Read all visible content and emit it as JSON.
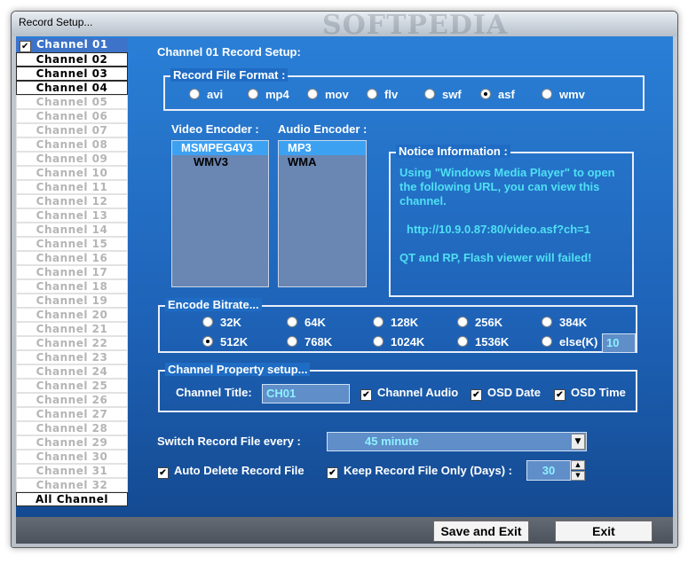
{
  "window": {
    "title": "Record Setup...",
    "watermark": "SOFTPEDIA"
  },
  "channels": {
    "items": [
      "Channel 01",
      "Channel 02",
      "Channel 03",
      "Channel 04",
      "Channel 05",
      "Channel 06",
      "Channel 07",
      "Channel 08",
      "Channel 09",
      "Channel 10",
      "Channel 11",
      "Channel 12",
      "Channel 13",
      "Channel 14",
      "Channel 15",
      "Channel 16",
      "Channel 17",
      "Channel 18",
      "Channel 19",
      "Channel 20",
      "Channel 21",
      "Channel 22",
      "Channel 23",
      "Channel 24",
      "Channel 25",
      "Channel 26",
      "Channel 27",
      "Channel 28",
      "Channel 29",
      "Channel 30",
      "Channel 31",
      "Channel 32"
    ],
    "active_indices": [
      1,
      2,
      3
    ],
    "selected_index": 0,
    "all_label": "All Channel"
  },
  "setup": {
    "heading": "Channel 01 Record Setup:",
    "format_legend": "Record File Format :",
    "formats": [
      "avi",
      "mp4",
      "mov",
      "flv",
      "swf",
      "asf",
      "wmv"
    ],
    "format_selected": "asf"
  },
  "encoders": {
    "video_label": "Video Encoder :",
    "audio_label": "Audio Encoder :",
    "video": [
      "MSMPEG4V3",
      "WMV3"
    ],
    "video_selected": "MSMPEG4V3",
    "audio": [
      "MP3",
      "WMA"
    ],
    "audio_selected": "MP3"
  },
  "notice": {
    "legend": "Notice Information :",
    "line1": "Using \"Windows Media Player\" to open the following URL, you can view this channel.",
    "url": "http://10.9.0.87:80/video.asf?ch=1",
    "line2": "QT and RP, Flash viewer will failed!"
  },
  "bitrate": {
    "legend": "Encode Bitrate...",
    "row1": [
      "32K",
      "64K",
      "128K",
      "256K",
      "384K"
    ],
    "row2": [
      "512K",
      "768K",
      "1024K",
      "1536K",
      "else(K)"
    ],
    "selected": "512K",
    "else_value": "10"
  },
  "property": {
    "legend": "Channel Property setup...",
    "title_label": "Channel Title:",
    "title_value": "CH01",
    "audio_label": "Channel Audio",
    "osd_date_label": "OSD Date",
    "osd_time_label": "OSD Time"
  },
  "options": {
    "switch_label": "Switch Record File every :",
    "switch_value": "45 minute",
    "auto_delete_label": "Auto Delete Record File",
    "keep_label": "Keep Record File Only (Days) :",
    "keep_days": "30"
  },
  "footer": {
    "save_label": "Save and Exit",
    "exit_label": "Exit"
  },
  "colors": {
    "accent": "#1f6cc4",
    "notice_text": "#4fe0f3",
    "list_selected": "#3da1f2"
  }
}
